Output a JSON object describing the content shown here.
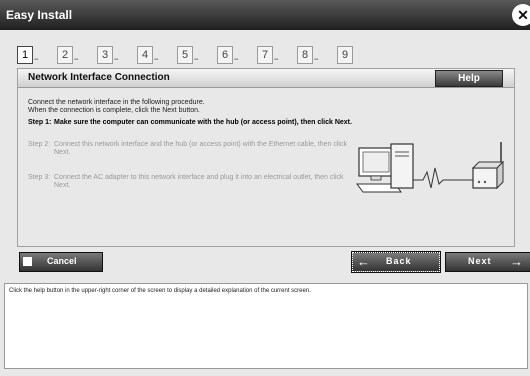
{
  "window": {
    "title": "Easy Install"
  },
  "steps": [
    "1",
    "2",
    "3",
    "4",
    "5",
    "6",
    "7",
    "8",
    "9"
  ],
  "step_dots": "▪▪▪",
  "panel": {
    "title": "Network Interface Connection",
    "help_label": "Help",
    "intro_line1": "Connect the network interface in the following procedure.",
    "intro_line2": "When the connection is complete, click the Next button.",
    "step1_label": "Step 1:",
    "step1_text": "Make sure the computer can communicate with the hub (or access point), then click Next.",
    "step2_label": "Step 2:",
    "step2_text": "Connect this network interface and the hub (or access point) with the Ethernet cable, then click Next.",
    "step3_label": "Step 3:",
    "step3_text": "Connect the AC adapter to this network interface and plug it into an electrical outlet, then click Next."
  },
  "buttons": {
    "cancel": "Cancel",
    "back": "Back",
    "next": "Next"
  },
  "info": {
    "text": "Click the help button in the upper-right corner of the screen to display a detailed explanation of the current screen."
  }
}
